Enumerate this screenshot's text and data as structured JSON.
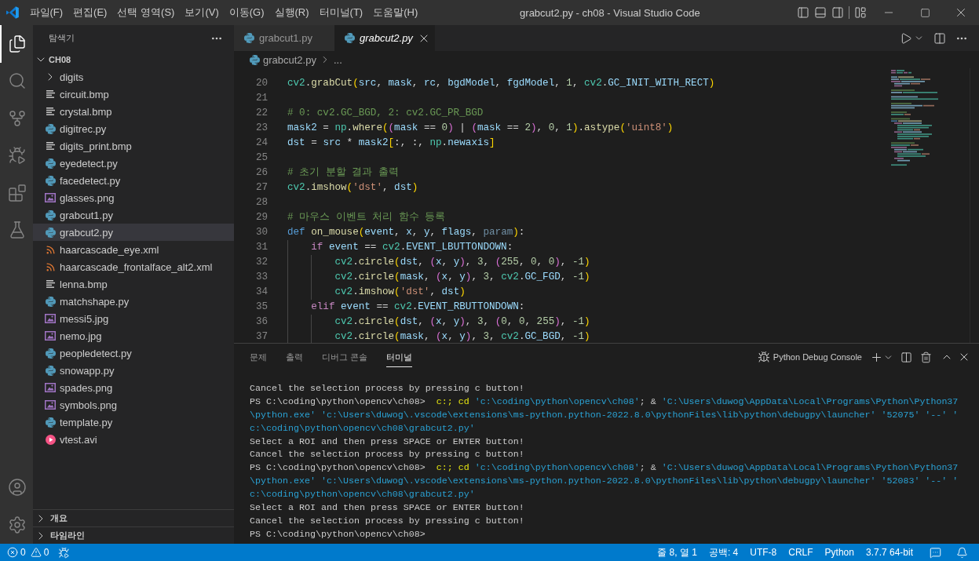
{
  "title_bar": {
    "menu": [
      "파일(F)",
      "편집(E)",
      "선택 영역(S)",
      "보기(V)",
      "이동(G)",
      "실행(R)",
      "터미널(T)",
      "도움말(H)"
    ],
    "title": "grabcut2.py - ch08 - Visual Studio Code"
  },
  "activity_bar": {
    "top": [
      {
        "kind": "explorer",
        "selected": true
      },
      {
        "kind": "search",
        "selected": false
      },
      {
        "kind": "source_control",
        "selected": false
      },
      {
        "kind": "run_debug",
        "selected": false
      },
      {
        "kind": "extensions",
        "selected": false
      },
      {
        "kind": "testing",
        "selected": false
      }
    ],
    "bottom": [
      {
        "kind": "account"
      },
      {
        "kind": "settings"
      }
    ]
  },
  "sidebar": {
    "title": "탐색기",
    "folder": {
      "name": "CH08",
      "expanded": true,
      "children": [
        {
          "name": "digits",
          "kind": "folder",
          "expanded": false,
          "selected": false
        },
        {
          "name": "circuit.bmp",
          "kind": "bitmap",
          "selected": false
        },
        {
          "name": "crystal.bmp",
          "kind": "bitmap",
          "selected": false
        },
        {
          "name": "digitrec.py",
          "kind": "python",
          "selected": false
        },
        {
          "name": "digits_print.bmp",
          "kind": "bitmap",
          "selected": false
        },
        {
          "name": "eyedetect.py",
          "kind": "python",
          "selected": false
        },
        {
          "name": "facedetect.py",
          "kind": "python",
          "selected": false
        },
        {
          "name": "glasses.png",
          "kind": "image",
          "selected": false
        },
        {
          "name": "grabcut1.py",
          "kind": "python",
          "selected": false
        },
        {
          "name": "grabcut2.py",
          "kind": "python",
          "selected": true
        },
        {
          "name": "haarcascade_eye.xml",
          "kind": "xml",
          "selected": false
        },
        {
          "name": "haarcascade_frontalface_alt2.xml",
          "kind": "xml",
          "selected": false
        },
        {
          "name": "lenna.bmp",
          "kind": "bitmap",
          "selected": false
        },
        {
          "name": "matchshape.py",
          "kind": "python",
          "selected": false
        },
        {
          "name": "messi5.jpg",
          "kind": "image",
          "selected": false
        },
        {
          "name": "nemo.jpg",
          "kind": "image",
          "selected": false
        },
        {
          "name": "peopledetect.py",
          "kind": "python",
          "selected": false
        },
        {
          "name": "snowapp.py",
          "kind": "python",
          "selected": false
        },
        {
          "name": "spades.png",
          "kind": "image",
          "selected": false
        },
        {
          "name": "symbols.png",
          "kind": "image",
          "selected": false
        },
        {
          "name": "template.py",
          "kind": "python",
          "selected": false
        },
        {
          "name": "vtest.avi",
          "kind": "video",
          "selected": false
        }
      ]
    },
    "sections": [
      {
        "label": "개요",
        "expanded": false
      },
      {
        "label": "타임라인",
        "expanded": false
      }
    ]
  },
  "editor": {
    "tabs": [
      {
        "label": "grabcut1.py",
        "selected": false,
        "preview": false
      },
      {
        "label": "grabcut2.py",
        "selected": true,
        "preview": true
      }
    ],
    "breadcrumb": [
      "grabcut2.py",
      "..."
    ],
    "lines": [
      {
        "number": "20",
        "tokens": [
          {
            "kind": "module",
            "text": "cv2"
          },
          {
            "kind": "punct",
            "text": "."
          },
          {
            "kind": "function",
            "text": "grabCut"
          },
          {
            "kind": "bracket1",
            "text": "("
          },
          {
            "kind": "variable",
            "text": "src"
          },
          {
            "kind": "punct",
            "text": ", "
          },
          {
            "kind": "variable",
            "text": "mask"
          },
          {
            "kind": "punct",
            "text": ", "
          },
          {
            "kind": "variable",
            "text": "rc"
          },
          {
            "kind": "punct",
            "text": ", "
          },
          {
            "kind": "variable",
            "text": "bgdModel"
          },
          {
            "kind": "punct",
            "text": ", "
          },
          {
            "kind": "variable",
            "text": "fgdModel"
          },
          {
            "kind": "punct",
            "text": ", "
          },
          {
            "kind": "number",
            "text": "1"
          },
          {
            "kind": "punct",
            "text": ", "
          },
          {
            "kind": "module",
            "text": "cv2"
          },
          {
            "kind": "punct",
            "text": "."
          },
          {
            "kind": "variable",
            "text": "GC_INIT_WITH_RECT"
          },
          {
            "kind": "bracket1",
            "text": ")"
          }
        ]
      },
      {
        "number": "21"
      },
      {
        "number": "22",
        "tokens": [
          {
            "kind": "comment",
            "text": "# 0: cv2.GC_BGD, 2: cv2.GC_PR_BGD"
          }
        ]
      },
      {
        "number": "23",
        "tokens": [
          {
            "kind": "variable",
            "text": "mask2"
          },
          {
            "kind": "punct",
            "text": " = "
          },
          {
            "kind": "module",
            "text": "np"
          },
          {
            "kind": "punct",
            "text": "."
          },
          {
            "kind": "function",
            "text": "where"
          },
          {
            "kind": "bracket1",
            "text": "("
          },
          {
            "kind": "bracket2",
            "text": "("
          },
          {
            "kind": "variable",
            "text": "mask"
          },
          {
            "kind": "punct",
            "text": " == "
          },
          {
            "kind": "number",
            "text": "0"
          },
          {
            "kind": "bracket2",
            "text": ")"
          },
          {
            "kind": "punct",
            "text": " | "
          },
          {
            "kind": "bracket2",
            "text": "("
          },
          {
            "kind": "variable",
            "text": "mask"
          },
          {
            "kind": "punct",
            "text": " == "
          },
          {
            "kind": "number",
            "text": "2"
          },
          {
            "kind": "bracket2",
            "text": ")"
          },
          {
            "kind": "punct",
            "text": ", "
          },
          {
            "kind": "number",
            "text": "0"
          },
          {
            "kind": "punct",
            "text": ", "
          },
          {
            "kind": "number",
            "text": "1"
          },
          {
            "kind": "bracket1",
            "text": ")"
          },
          {
            "kind": "punct",
            "text": "."
          },
          {
            "kind": "function",
            "text": "astype"
          },
          {
            "kind": "bracket1",
            "text": "("
          },
          {
            "kind": "string",
            "text": "'uint8'"
          },
          {
            "kind": "bracket1",
            "text": ")"
          }
        ]
      },
      {
        "number": "24",
        "tokens": [
          {
            "kind": "variable",
            "text": "dst"
          },
          {
            "kind": "punct",
            "text": " = "
          },
          {
            "kind": "variable",
            "text": "src"
          },
          {
            "kind": "punct",
            "text": " * "
          },
          {
            "kind": "variable",
            "text": "mask2"
          },
          {
            "kind": "bracket1",
            "text": "["
          },
          {
            "kind": "punct",
            "text": ":, :, "
          },
          {
            "kind": "module",
            "text": "np"
          },
          {
            "kind": "punct",
            "text": "."
          },
          {
            "kind": "variable",
            "text": "newaxis"
          },
          {
            "kind": "bracket1",
            "text": "]"
          }
        ]
      },
      {
        "number": "25"
      },
      {
        "number": "26",
        "tokens": [
          {
            "kind": "comment",
            "text": "# 초기 분할 결과 출력"
          }
        ]
      },
      {
        "number": "27",
        "tokens": [
          {
            "kind": "module",
            "text": "cv2"
          },
          {
            "kind": "punct",
            "text": "."
          },
          {
            "kind": "function",
            "text": "imshow"
          },
          {
            "kind": "bracket1",
            "text": "("
          },
          {
            "kind": "string",
            "text": "'dst'"
          },
          {
            "kind": "punct",
            "text": ", "
          },
          {
            "kind": "variable",
            "text": "dst"
          },
          {
            "kind": "bracket1",
            "text": ")"
          }
        ]
      },
      {
        "number": "28"
      },
      {
        "number": "29",
        "tokens": [
          {
            "kind": "comment",
            "text": "# 마우스 이벤트 처리 함수 등록"
          }
        ]
      },
      {
        "number": "30",
        "tokens": [
          {
            "kind": "keyword",
            "text": "def "
          },
          {
            "kind": "function",
            "text": "on_mouse"
          },
          {
            "kind": "bracket1",
            "text": "("
          },
          {
            "kind": "variable",
            "text": "event"
          },
          {
            "kind": "punct",
            "text": ", "
          },
          {
            "kind": "variable",
            "text": "x"
          },
          {
            "kind": "punct",
            "text": ", "
          },
          {
            "kind": "variable",
            "text": "y"
          },
          {
            "kind": "punct",
            "text": ", "
          },
          {
            "kind": "variable",
            "text": "flags"
          },
          {
            "kind": "punct",
            "text": ", "
          },
          {
            "kind": "unused",
            "text": "param"
          },
          {
            "kind": "bracket1",
            "text": ")"
          },
          {
            "kind": "punct",
            "text": ":"
          }
        ],
        "children": [
          {
            "number": "31",
            "tokens": [
              {
                "kind": "control",
                "text": "if "
              },
              {
                "kind": "variable",
                "text": "event"
              },
              {
                "kind": "punct",
                "text": " == "
              },
              {
                "kind": "module",
                "text": "cv2"
              },
              {
                "kind": "punct",
                "text": "."
              },
              {
                "kind": "variable",
                "text": "EVENT_LBUTTONDOWN"
              },
              {
                "kind": "punct",
                "text": ":"
              }
            ],
            "children": [
              {
                "number": "32",
                "tokens": [
                  {
                    "kind": "module",
                    "text": "cv2"
                  },
                  {
                    "kind": "punct",
                    "text": "."
                  },
                  {
                    "kind": "function",
                    "text": "circle"
                  },
                  {
                    "kind": "bracket1",
                    "text": "("
                  },
                  {
                    "kind": "variable",
                    "text": "dst"
                  },
                  {
                    "kind": "punct",
                    "text": ", "
                  },
                  {
                    "kind": "bracket2",
                    "text": "("
                  },
                  {
                    "kind": "variable",
                    "text": "x"
                  },
                  {
                    "kind": "punct",
                    "text": ", "
                  },
                  {
                    "kind": "variable",
                    "text": "y"
                  },
                  {
                    "kind": "bracket2",
                    "text": ")"
                  },
                  {
                    "kind": "punct",
                    "text": ", "
                  },
                  {
                    "kind": "number",
                    "text": "3"
                  },
                  {
                    "kind": "punct",
                    "text": ", "
                  },
                  {
                    "kind": "bracket2",
                    "text": "("
                  },
                  {
                    "kind": "number",
                    "text": "255"
                  },
                  {
                    "kind": "punct",
                    "text": ", "
                  },
                  {
                    "kind": "number",
                    "text": "0"
                  },
                  {
                    "kind": "punct",
                    "text": ", "
                  },
                  {
                    "kind": "number",
                    "text": "0"
                  },
                  {
                    "kind": "bracket2",
                    "text": ")"
                  },
                  {
                    "kind": "punct",
                    "text": ", "
                  },
                  {
                    "kind": "number",
                    "text": "-1"
                  },
                  {
                    "kind": "bracket1",
                    "text": ")"
                  }
                ]
              },
              {
                "number": "33",
                "tokens": [
                  {
                    "kind": "module",
                    "text": "cv2"
                  },
                  {
                    "kind": "punct",
                    "text": "."
                  },
                  {
                    "kind": "function",
                    "text": "circle"
                  },
                  {
                    "kind": "bracket1",
                    "text": "("
                  },
                  {
                    "kind": "variable",
                    "text": "mask"
                  },
                  {
                    "kind": "punct",
                    "text": ", "
                  },
                  {
                    "kind": "bracket2",
                    "text": "("
                  },
                  {
                    "kind": "variable",
                    "text": "x"
                  },
                  {
                    "kind": "punct",
                    "text": ", "
                  },
                  {
                    "kind": "variable",
                    "text": "y"
                  },
                  {
                    "kind": "bracket2",
                    "text": ")"
                  },
                  {
                    "kind": "punct",
                    "text": ", "
                  },
                  {
                    "kind": "number",
                    "text": "3"
                  },
                  {
                    "kind": "punct",
                    "text": ", "
                  },
                  {
                    "kind": "module",
                    "text": "cv2"
                  },
                  {
                    "kind": "punct",
                    "text": "."
                  },
                  {
                    "kind": "variable",
                    "text": "GC_FGD"
                  },
                  {
                    "kind": "punct",
                    "text": ", "
                  },
                  {
                    "kind": "number",
                    "text": "-1"
                  },
                  {
                    "kind": "bracket1",
                    "text": ")"
                  }
                ]
              },
              {
                "number": "34",
                "tokens": [
                  {
                    "kind": "module",
                    "text": "cv2"
                  },
                  {
                    "kind": "punct",
                    "text": "."
                  },
                  {
                    "kind": "function",
                    "text": "imshow"
                  },
                  {
                    "kind": "bracket1",
                    "text": "("
                  },
                  {
                    "kind": "string",
                    "text": "'dst'"
                  },
                  {
                    "kind": "punct",
                    "text": ", "
                  },
                  {
                    "kind": "variable",
                    "text": "dst"
                  },
                  {
                    "kind": "bracket1",
                    "text": ")"
                  }
                ]
              }
            ]
          },
          {
            "number": "35",
            "tokens": [
              {
                "kind": "control",
                "text": "elif "
              },
              {
                "kind": "variable",
                "text": "event"
              },
              {
                "kind": "punct",
                "text": " == "
              },
              {
                "kind": "module",
                "text": "cv2"
              },
              {
                "kind": "punct",
                "text": "."
              },
              {
                "kind": "variable",
                "text": "EVENT_RBUTTONDOWN"
              },
              {
                "kind": "punct",
                "text": ":"
              }
            ],
            "children": [
              {
                "number": "36",
                "tokens": [
                  {
                    "kind": "module",
                    "text": "cv2"
                  },
                  {
                    "kind": "punct",
                    "text": "."
                  },
                  {
                    "kind": "function",
                    "text": "circle"
                  },
                  {
                    "kind": "bracket1",
                    "text": "("
                  },
                  {
                    "kind": "variable",
                    "text": "dst"
                  },
                  {
                    "kind": "punct",
                    "text": ", "
                  },
                  {
                    "kind": "bracket2",
                    "text": "("
                  },
                  {
                    "kind": "variable",
                    "text": "x"
                  },
                  {
                    "kind": "punct",
                    "text": ", "
                  },
                  {
                    "kind": "variable",
                    "text": "y"
                  },
                  {
                    "kind": "bracket2",
                    "text": ")"
                  },
                  {
                    "kind": "punct",
                    "text": ", "
                  },
                  {
                    "kind": "number",
                    "text": "3"
                  },
                  {
                    "kind": "punct",
                    "text": ", "
                  },
                  {
                    "kind": "bracket2",
                    "text": "("
                  },
                  {
                    "kind": "number",
                    "text": "0"
                  },
                  {
                    "kind": "punct",
                    "text": ", "
                  },
                  {
                    "kind": "number",
                    "text": "0"
                  },
                  {
                    "kind": "punct",
                    "text": ", "
                  },
                  {
                    "kind": "number",
                    "text": "255"
                  },
                  {
                    "kind": "bracket2",
                    "text": ")"
                  },
                  {
                    "kind": "punct",
                    "text": ", "
                  },
                  {
                    "kind": "number",
                    "text": "-1"
                  },
                  {
                    "kind": "bracket1",
                    "text": ")"
                  }
                ]
              },
              {
                "number": "37",
                "tokens": [
                  {
                    "kind": "module",
                    "text": "cv2"
                  },
                  {
                    "kind": "punct",
                    "text": "."
                  },
                  {
                    "kind": "function",
                    "text": "circle"
                  },
                  {
                    "kind": "bracket1",
                    "text": "("
                  },
                  {
                    "kind": "variable",
                    "text": "mask"
                  },
                  {
                    "kind": "punct",
                    "text": ", "
                  },
                  {
                    "kind": "bracket2",
                    "text": "("
                  },
                  {
                    "kind": "variable",
                    "text": "x"
                  },
                  {
                    "kind": "punct",
                    "text": ", "
                  },
                  {
                    "kind": "variable",
                    "text": "y"
                  },
                  {
                    "kind": "bracket2",
                    "text": ")"
                  },
                  {
                    "kind": "punct",
                    "text": ", "
                  },
                  {
                    "kind": "number",
                    "text": "3"
                  },
                  {
                    "kind": "punct",
                    "text": ", "
                  },
                  {
                    "kind": "module",
                    "text": "cv2"
                  },
                  {
                    "kind": "punct",
                    "text": "."
                  },
                  {
                    "kind": "variable",
                    "text": "GC_BGD"
                  },
                  {
                    "kind": "punct",
                    "text": ", "
                  },
                  {
                    "kind": "number",
                    "text": "-1"
                  },
                  {
                    "kind": "bracket1",
                    "text": ")"
                  }
                ]
              }
            ]
          }
        ]
      }
    ]
  },
  "panel": {
    "tabs": [
      {
        "label": "문제",
        "selected": false
      },
      {
        "label": "출력",
        "selected": false
      },
      {
        "label": "디버그 콘솔",
        "selected": false
      },
      {
        "label": "터미널",
        "selected": true
      }
    ],
    "terminal_name": "Python Debug Console",
    "lines": [
      {
        "tokens": [
          {
            "kind": "output",
            "text": "Cancel the selection process by pressing c button!"
          }
        ]
      },
      {
        "tokens": [
          {
            "kind": "output",
            "text": "PS C:\\coding\\python\\opencv\\ch08>  "
          },
          {
            "kind": "command",
            "text": "c:; cd "
          },
          {
            "kind": "string",
            "text": "'c:\\coding\\python\\opencv\\ch08'"
          },
          {
            "kind": "output",
            "text": "; & "
          },
          {
            "kind": "string",
            "text": "'C:\\Users\\duwog\\AppData\\Local\\Programs\\Python\\Python37"
          }
        ]
      },
      {
        "tokens": [
          {
            "kind": "string",
            "text": "\\python.exe' 'c:\\Users\\duwog\\.vscode\\extensions\\ms-python.python-2022.8.0\\pythonFiles\\lib\\python\\debugpy\\launcher' '52075' '--' '"
          }
        ]
      },
      {
        "tokens": [
          {
            "kind": "string",
            "text": "c:\\coding\\python\\opencv\\ch08\\grabcut2.py'"
          }
        ]
      },
      {
        "tokens": [
          {
            "kind": "output",
            "text": "Select a ROI and then press SPACE or ENTER button!"
          }
        ]
      },
      {
        "tokens": [
          {
            "kind": "output",
            "text": "Cancel the selection process by pressing c button!"
          }
        ]
      },
      {
        "tokens": [
          {
            "kind": "output",
            "text": "PS C:\\coding\\python\\opencv\\ch08>  "
          },
          {
            "kind": "command",
            "text": "c:; cd "
          },
          {
            "kind": "string",
            "text": "'c:\\coding\\python\\opencv\\ch08'"
          },
          {
            "kind": "output",
            "text": "; & "
          },
          {
            "kind": "string",
            "text": "'C:\\Users\\duwog\\AppData\\Local\\Programs\\Python\\Python37"
          }
        ]
      },
      {
        "tokens": [
          {
            "kind": "string",
            "text": "\\python.exe' 'c:\\Users\\duwog\\.vscode\\extensions\\ms-python.python-2022.8.0\\pythonFiles\\lib\\python\\debugpy\\launcher' '52083' '--' '"
          }
        ]
      },
      {
        "tokens": [
          {
            "kind": "string",
            "text": "c:\\coding\\python\\opencv\\ch08\\grabcut2.py'"
          }
        ]
      },
      {
        "tokens": [
          {
            "kind": "output",
            "text": "Select a ROI and then press SPACE or ENTER button!"
          }
        ]
      },
      {
        "tokens": [
          {
            "kind": "output",
            "text": "Cancel the selection process by pressing c button!"
          }
        ]
      },
      {
        "tokens": [
          {
            "kind": "output",
            "text": "PS C:\\coding\\python\\opencv\\ch08>"
          }
        ]
      }
    ]
  },
  "status_bar": {
    "errors": "0",
    "warnings": "0",
    "items": [
      "줄 8, 열 1",
      "공백: 4",
      "UTF-8",
      "CRLF",
      "Python",
      "3.7.7 64-bit"
    ]
  }
}
